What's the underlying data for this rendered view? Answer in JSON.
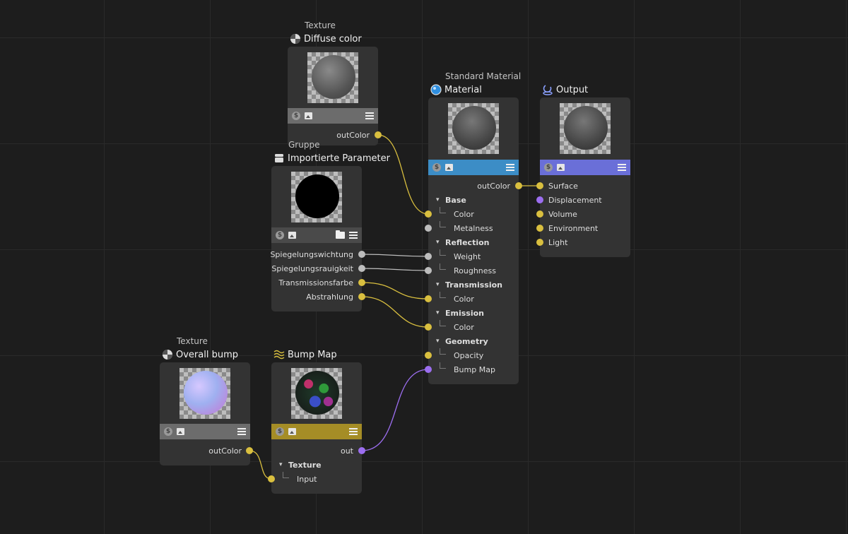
{
  "nodes": {
    "diffuse": {
      "subtitle": "Texture",
      "title": "Diffuse color",
      "icon": "texture-icon",
      "outputs": [
        "outColor"
      ],
      "toolbar_color": "#6c6c6c"
    },
    "import_params": {
      "subtitle": "Gruppe",
      "title": "Importierte Parameter",
      "icon": "group-icon",
      "outputs": [
        "Spiegelungswichtung",
        "Spiegelungsrauigkeit",
        "Transmissionsfarbe",
        "Abstrahlung"
      ],
      "toolbar_color": "#4a4a4a"
    },
    "material": {
      "subtitle": "Standard Material",
      "title": "Material",
      "icon": "material-icon",
      "output": "outColor",
      "groups": [
        {
          "label": "Base",
          "inputs": [
            "Color",
            "Metalness"
          ]
        },
        {
          "label": "Reflection",
          "inputs": [
            "Weight",
            "Roughness"
          ]
        },
        {
          "label": "Transmission",
          "inputs": [
            "Color"
          ]
        },
        {
          "label": "Emission",
          "inputs": [
            "Color"
          ]
        },
        {
          "label": "Geometry",
          "inputs": [
            "Opacity",
            "Bump Map"
          ]
        }
      ],
      "toolbar_color": "#3c8dc6"
    },
    "output": {
      "title": "Output",
      "icon": "output-icon",
      "inputs": [
        "Surface",
        "Displacement",
        "Volume",
        "Environment",
        "Light"
      ],
      "toolbar_color": "#6a6fd8"
    },
    "overall_bump": {
      "subtitle": "Texture",
      "title": "Overall bump",
      "icon": "texture-icon",
      "outputs": [
        "outColor"
      ],
      "toolbar_color": "#6c6c6c"
    },
    "bump_map": {
      "title": "Bump Map",
      "icon": "bump-map-icon",
      "output": "out",
      "group": "Texture",
      "inputs": [
        "Input"
      ],
      "toolbar_color": "#a58d26"
    }
  },
  "colors": {
    "port_yellow": "#d9bf3f",
    "port_gray": "#bdbdbd",
    "port_purple": "#9c6ef0",
    "background": "#1d1d1d",
    "node_body": "#333333"
  }
}
